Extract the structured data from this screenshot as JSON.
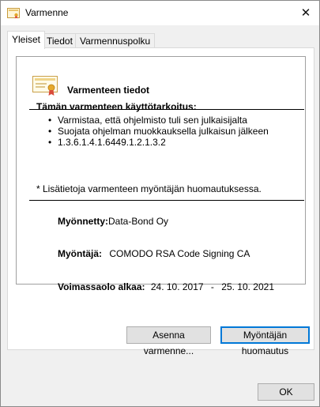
{
  "window": {
    "title": "Varmenne",
    "close_glyph": "✕"
  },
  "tabs": [
    {
      "label": "Yleiset",
      "active": true
    },
    {
      "label": "Tiedot",
      "active": false
    },
    {
      "label": "Varmennuspolku",
      "active": false
    }
  ],
  "info": {
    "icon": "certificate-icon",
    "heading": "Varmenteen tiedot",
    "purpose_title": "Tämän varmenteen käyttötarkoitus:",
    "purposes": [
      "Varmistaa, että ohjelmisto tuli sen julkaisijalta",
      "Suojata ohjelman muokkauksella julkaisun jälkeen",
      "1.3.6.1.4.1.6449.1.2.1.3.2"
    ],
    "footnote": "* Lisätietoja varmenteen myöntäjän huomautuksessa.",
    "issued_to_label": "Myönnetty:",
    "issued_to_value": "Data-Bond Oy",
    "issuer_label": "Myöntäjä:",
    "issuer_value": "COMODO RSA Code Signing CA",
    "valid_label": "Voimassaolo alkaa:",
    "valid_from": "24. 10. 2017",
    "valid_to_sep": "-",
    "valid_to": "25. 10. 2021"
  },
  "buttons": {
    "install": "Asenna varmenne...",
    "issuer_statement": "Myöntäjän huomautus",
    "ok": "OK"
  },
  "colors": {
    "focus": "#0078d7",
    "window_bg": "#f0f0f0"
  }
}
